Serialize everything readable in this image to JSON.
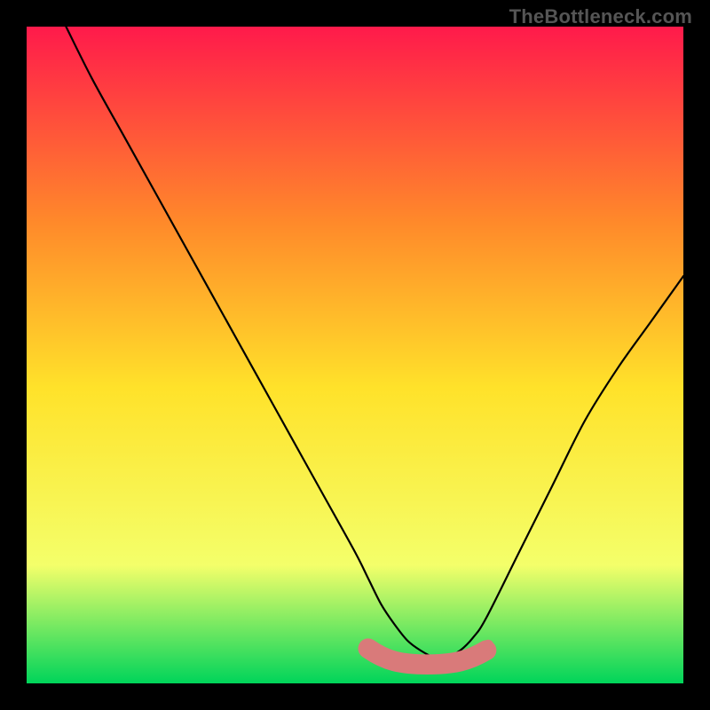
{
  "watermark": "TheBottleneck.com",
  "chart_data": {
    "type": "line",
    "title": "",
    "xlabel": "",
    "ylabel": "",
    "xlim": [
      0,
      100
    ],
    "ylim": [
      0,
      100
    ],
    "background_gradient": {
      "top": "#ff1a4b",
      "mid_upper": "#ff8a2a",
      "mid": "#ffe22a",
      "mid_lower": "#f4ff6a",
      "bottom": "#00d45a"
    },
    "series": [
      {
        "name": "curve",
        "color": "#000000",
        "x": [
          6,
          10,
          15,
          20,
          25,
          30,
          35,
          40,
          45,
          50,
          52,
          54,
          56,
          58,
          60,
          62,
          64,
          66,
          68,
          70,
          75,
          80,
          85,
          90,
          95,
          100
        ],
        "y": [
          100,
          92,
          83,
          74,
          65,
          56,
          47,
          38,
          29,
          20,
          16,
          12,
          9,
          6.5,
          5,
          4,
          4,
          5,
          7,
          10,
          20,
          30,
          40,
          48,
          55,
          62
        ]
      }
    ],
    "optimal_band": {
      "name": "optimal-range-marker",
      "color": "#d97a7a",
      "x_start": 52,
      "x_end": 70,
      "y": 4.5,
      "thickness": 3.2
    }
  }
}
